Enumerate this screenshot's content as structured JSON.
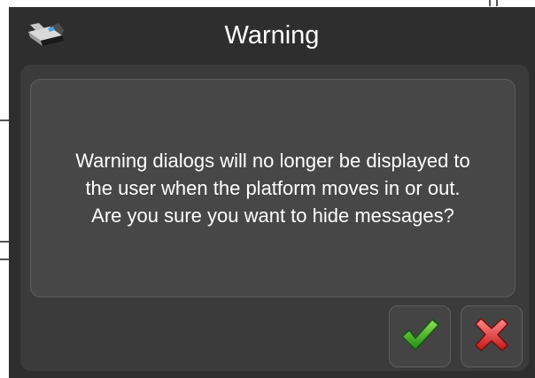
{
  "dialog": {
    "title": "Warning",
    "title_icon": "platform-icon",
    "message_lines": [
      "Warning dialogs will no longer be displayed to",
      "the user when the platform moves in or out.",
      "Are you sure you want to hide messages?"
    ],
    "confirm_icon": "checkmark-icon",
    "cancel_icon": "cross-icon"
  },
  "colors": {
    "background": "#2e2e2e",
    "panel": "#3b3b3b",
    "message_box": "#474747",
    "confirm": "#3ea31b",
    "cancel": "#e03a3a"
  }
}
